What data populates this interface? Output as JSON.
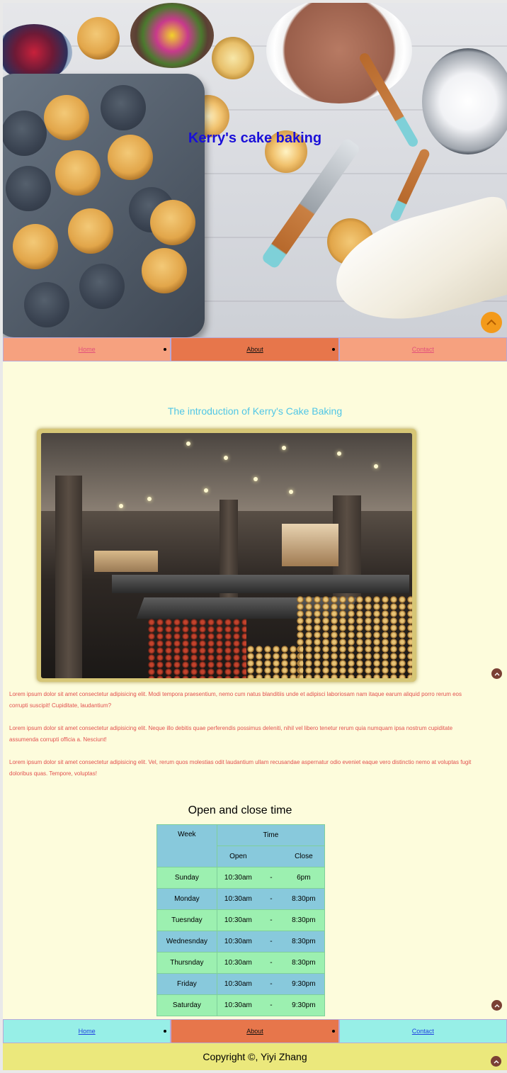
{
  "hero": {
    "title": "Kerry's cake baking"
  },
  "nav": {
    "items": [
      {
        "label": "Home"
      },
      {
        "label": "About"
      },
      {
        "label": "Contact"
      }
    ]
  },
  "intro": {
    "title": "The introduction of Kerry's Cake Baking",
    "paragraphs": [
      "Lorem ipsum dolor sit amet consectetur adipisicing elit. Modi tempora praesentium, nemo cum natus blanditiis unde et adipisci laboriosam nam itaque earum aliquid porro rerum eos corrupti suscipit! Cupiditate, laudantium?",
      "Lorem ipsum dolor sit amet consectetur adipisicing elit. Neque illo debitis quae perferendis possimus deleniti, nihil vel libero tenetur rerum quia numquam ipsa nostrum cupiditate assumenda corrupti officia a. Nesciunt!",
      "Lorem ipsum dolor sit amet consectetur adipisicing elit. Vel, rerum quos molestias odit laudantium ullam recusandae aspernatur odio eveniet eaque vero distinctio nemo at voluptas fugit doloribus quas. Tempore, voluptas!"
    ]
  },
  "hours": {
    "title": "Open and close time",
    "header": {
      "week": "Week",
      "time": "Time",
      "open": "Open",
      "close": "Close"
    },
    "rows": [
      {
        "day": "Sunday",
        "open": "10:30am",
        "sep": "-",
        "close": "6pm"
      },
      {
        "day": "Monday",
        "open": "10:30am",
        "sep": "-",
        "close": "8:30pm"
      },
      {
        "day": "Tuesnday",
        "open": "10:30am",
        "sep": "-",
        "close": "8:30pm"
      },
      {
        "day": "Wednesnday",
        "open": "10:30am",
        "sep": "-",
        "close": "8:30pm"
      },
      {
        "day": "Thursnday",
        "open": "10:30am",
        "sep": "-",
        "close": "8:30pm"
      },
      {
        "day": "Friday",
        "open": "10:30am",
        "sep": "-",
        "close": "9:30pm"
      },
      {
        "day": "Saturday",
        "open": "10:30am",
        "sep": "-",
        "close": "9:30pm"
      }
    ]
  },
  "footer": {
    "copyright": "Copyright ©, Yiyi Zhang"
  },
  "icons": {
    "to_top_hero": "chevron-up-icon",
    "to_top": "chevron-up-icon"
  },
  "colors": {
    "hero_title": "#1a10d8",
    "intro_title": "#50c6e6",
    "paragraph": "#e2504f",
    "page_bg": "#fdfcdc",
    "nav_top": "#f6a17f",
    "nav_active": "#e7764b",
    "nav_bottom": "#97efe7",
    "footer_bg": "#ebe87c",
    "table_blue": "#88c9dc",
    "table_green": "#9cf0b0",
    "to_top_hero": "#f39a1b",
    "to_top": "#7a4034"
  }
}
